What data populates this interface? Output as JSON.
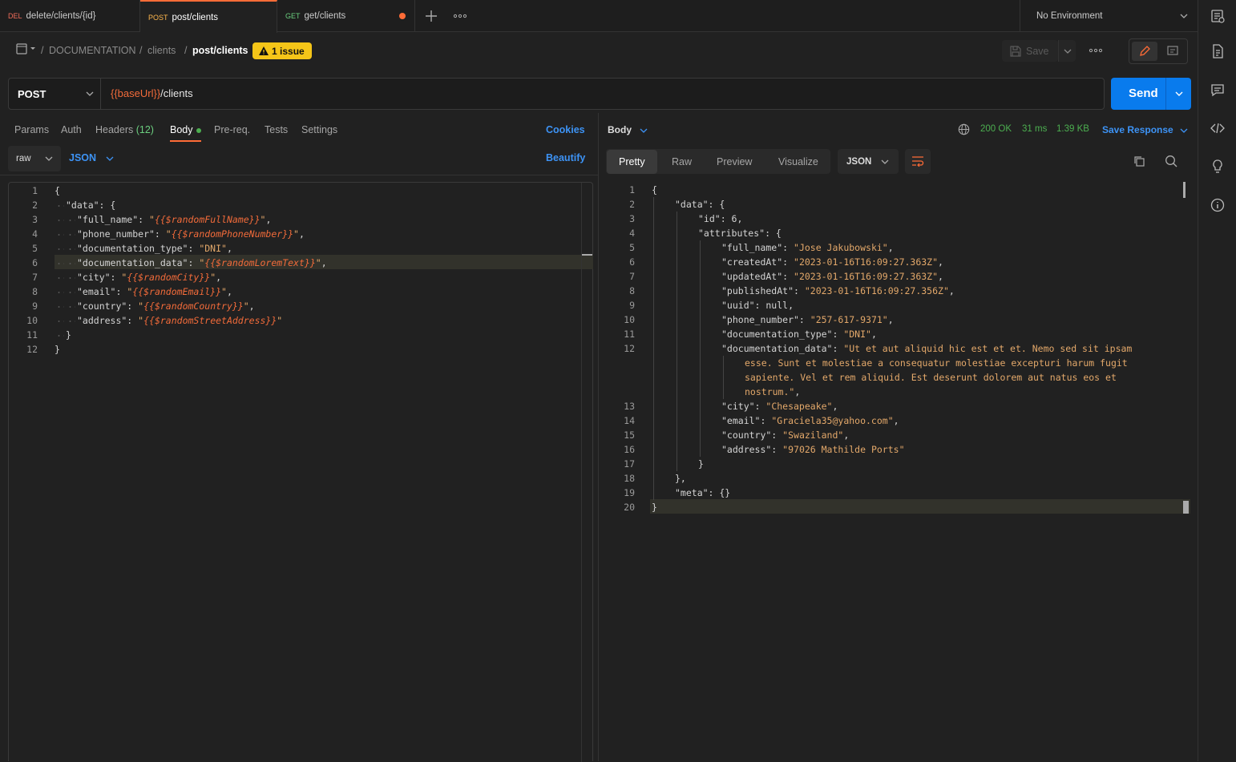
{
  "tabs": [
    {
      "method": "DEL",
      "label": "delete/clients/{id}",
      "method_color": "#f26d5b"
    },
    {
      "method": "POST",
      "label": "post/clients",
      "method_color": "#ffb74d"
    },
    {
      "method": "GET",
      "label": "get/clients",
      "method_color": "#6bcf7f"
    }
  ],
  "environment": "No Environment",
  "breadcrumb": {
    "root": "DOCUMENTATION",
    "folder": "clients",
    "current": "post/clients",
    "sep": "/"
  },
  "issue_label": "1 issue",
  "toolbar": {
    "save_label": "Save"
  },
  "request": {
    "method": "POST",
    "url_var": "{{baseUrl}}",
    "url_path": "/clients",
    "send_label": "Send"
  },
  "req_tabs": {
    "params": "Params",
    "auth": "Auth",
    "headers": "Headers",
    "headers_count": "(12)",
    "body": "Body",
    "prereq": "Pre-req.",
    "tests": "Tests",
    "settings": "Settings",
    "cookies": "Cookies"
  },
  "body_opts": {
    "mode": "raw",
    "lang": "JSON",
    "beautify": "Beautify"
  },
  "response": {
    "body_label": "Body",
    "status": "200 OK",
    "time": "31 ms",
    "size": "1.39 KB",
    "save_label": "Save Response",
    "views": [
      "Pretty",
      "Raw",
      "Preview",
      "Visualize"
    ],
    "format": "JSON"
  },
  "request_body_lines": [
    {
      "n": "1",
      "i": 0,
      "t": [
        [
          "k",
          "{"
        ]
      ]
    },
    {
      "n": "2",
      "i": 1,
      "t": [
        [
          "k",
          "\"data\": {"
        ]
      ]
    },
    {
      "n": "3",
      "i": 2,
      "t": [
        [
          "k",
          "\"full_name\": "
        ],
        [
          "s",
          "\""
        ],
        [
          "v",
          "{{$randomFullName}}"
        ],
        [
          "s",
          "\""
        ],
        [
          "k",
          ","
        ]
      ]
    },
    {
      "n": "4",
      "i": 2,
      "t": [
        [
          "k",
          "\"phone_number\": "
        ],
        [
          "s",
          "\""
        ],
        [
          "v",
          "{{$randomPhoneNumber}}"
        ],
        [
          "s",
          "\""
        ],
        [
          "k",
          ","
        ]
      ]
    },
    {
      "n": "5",
      "i": 2,
      "t": [
        [
          "k",
          "\"documentation_type\": "
        ],
        [
          "s",
          "\"DNI\""
        ],
        [
          "k",
          ","
        ]
      ]
    },
    {
      "n": "6",
      "i": 2,
      "t": [
        [
          "k",
          "\"documentation_data\": "
        ],
        [
          "s",
          "\""
        ],
        [
          "v",
          "{{$randomLoremText}}"
        ],
        [
          "s",
          "\""
        ],
        [
          "k",
          ","
        ]
      ]
    },
    {
      "n": "7",
      "i": 2,
      "t": [
        [
          "k",
          "\"city\": "
        ],
        [
          "s",
          "\""
        ],
        [
          "v",
          "{{$randomCity}}"
        ],
        [
          "s",
          "\""
        ],
        [
          "k",
          ","
        ]
      ]
    },
    {
      "n": "8",
      "i": 2,
      "t": [
        [
          "k",
          "\"email\": "
        ],
        [
          "s",
          "\""
        ],
        [
          "v",
          "{{$randomEmail}}"
        ],
        [
          "s",
          "\""
        ],
        [
          "k",
          ","
        ]
      ]
    },
    {
      "n": "9",
      "i": 2,
      "t": [
        [
          "k",
          "\"country\": "
        ],
        [
          "s",
          "\""
        ],
        [
          "v",
          "{{$randomCountry}}"
        ],
        [
          "s",
          "\""
        ],
        [
          "k",
          ","
        ]
      ]
    },
    {
      "n": "10",
      "i": 2,
      "t": [
        [
          "k",
          "\"address\": "
        ],
        [
          "s",
          "\""
        ],
        [
          "v",
          "{{$randomStreetAddress}}"
        ],
        [
          "s",
          "\""
        ]
      ]
    },
    {
      "n": "11",
      "i": 1,
      "t": [
        [
          "k",
          "}"
        ]
      ]
    },
    {
      "n": "12",
      "i": 0,
      "t": [
        [
          "k",
          "}"
        ]
      ]
    }
  ],
  "response_body_lines": [
    {
      "n": "1",
      "i": 0,
      "t": [
        [
          "k",
          "{"
        ]
      ]
    },
    {
      "n": "2",
      "i": 1,
      "t": [
        [
          "k",
          "\"data\": {"
        ]
      ]
    },
    {
      "n": "3",
      "i": 2,
      "t": [
        [
          "k",
          "\"id\": 6,"
        ]
      ]
    },
    {
      "n": "4",
      "i": 2,
      "t": [
        [
          "k",
          "\"attributes\": {"
        ]
      ]
    },
    {
      "n": "5",
      "i": 3,
      "t": [
        [
          "k",
          "\"full_name\": "
        ],
        [
          "s",
          "\"Jose Jakubowski\""
        ],
        [
          "k",
          ","
        ]
      ]
    },
    {
      "n": "6",
      "i": 3,
      "t": [
        [
          "k",
          "\"createdAt\": "
        ],
        [
          "s",
          "\"2023-01-16T16:09:27.363Z\""
        ],
        [
          "k",
          ","
        ]
      ]
    },
    {
      "n": "7",
      "i": 3,
      "t": [
        [
          "k",
          "\"updatedAt\": "
        ],
        [
          "s",
          "\"2023-01-16T16:09:27.363Z\""
        ],
        [
          "k",
          ","
        ]
      ]
    },
    {
      "n": "8",
      "i": 3,
      "t": [
        [
          "k",
          "\"publishedAt\": "
        ],
        [
          "s",
          "\"2023-01-16T16:09:27.356Z\""
        ],
        [
          "k",
          ","
        ]
      ]
    },
    {
      "n": "9",
      "i": 3,
      "t": [
        [
          "k",
          "\"uuid\": null,"
        ]
      ]
    },
    {
      "n": "10",
      "i": 3,
      "t": [
        [
          "k",
          "\"phone_number\": "
        ],
        [
          "s",
          "\"257-617-9371\""
        ],
        [
          "k",
          ","
        ]
      ]
    },
    {
      "n": "11",
      "i": 3,
      "t": [
        [
          "k",
          "\"documentation_type\": "
        ],
        [
          "s",
          "\"DNI\""
        ],
        [
          "k",
          ","
        ]
      ]
    },
    {
      "n": "12",
      "i": 3,
      "t": [
        [
          "k",
          "\"documentation_data\": "
        ],
        [
          "s",
          "\"Ut et aut aliquid hic est et et. Nemo sed sit ipsam"
        ]
      ]
    },
    {
      "n": "",
      "i": 4,
      "t": [
        [
          "s",
          "esse. Sunt et molestiae a consequatur molestiae excepturi harum fugit"
        ]
      ]
    },
    {
      "n": "",
      "i": 4,
      "t": [
        [
          "s",
          "sapiente. Vel et rem aliquid. Est deserunt dolorem aut natus eos et"
        ]
      ]
    },
    {
      "n": "",
      "i": 4,
      "t": [
        [
          "s",
          "nostrum.\""
        ],
        [
          "k",
          ","
        ]
      ]
    },
    {
      "n": "13",
      "i": 3,
      "t": [
        [
          "k",
          "\"city\": "
        ],
        [
          "s",
          "\"Chesapeake\""
        ],
        [
          "k",
          ","
        ]
      ]
    },
    {
      "n": "14",
      "i": 3,
      "t": [
        [
          "k",
          "\"email\": "
        ],
        [
          "s",
          "\"Graciela35@yahoo.com\""
        ],
        [
          "k",
          ","
        ]
      ]
    },
    {
      "n": "15",
      "i": 3,
      "t": [
        [
          "k",
          "\"country\": "
        ],
        [
          "s",
          "\"Swaziland\""
        ],
        [
          "k",
          ","
        ]
      ]
    },
    {
      "n": "16",
      "i": 3,
      "t": [
        [
          "k",
          "\"address\": "
        ],
        [
          "s",
          "\"97026 Mathilde Ports\""
        ]
      ]
    },
    {
      "n": "17",
      "i": 2,
      "t": [
        [
          "k",
          "}"
        ]
      ]
    },
    {
      "n": "18",
      "i": 1,
      "t": [
        [
          "k",
          "},"
        ]
      ]
    },
    {
      "n": "19",
      "i": 1,
      "t": [
        [
          "k",
          "\"meta\": {}"
        ]
      ]
    },
    {
      "n": "20",
      "i": 0,
      "t": [
        [
          "k",
          "}"
        ]
      ]
    }
  ],
  "colors": {
    "accent": "#ff6c37",
    "primary": "#097bed",
    "status_ok": "#4caf50",
    "issue": "#f5c518"
  }
}
